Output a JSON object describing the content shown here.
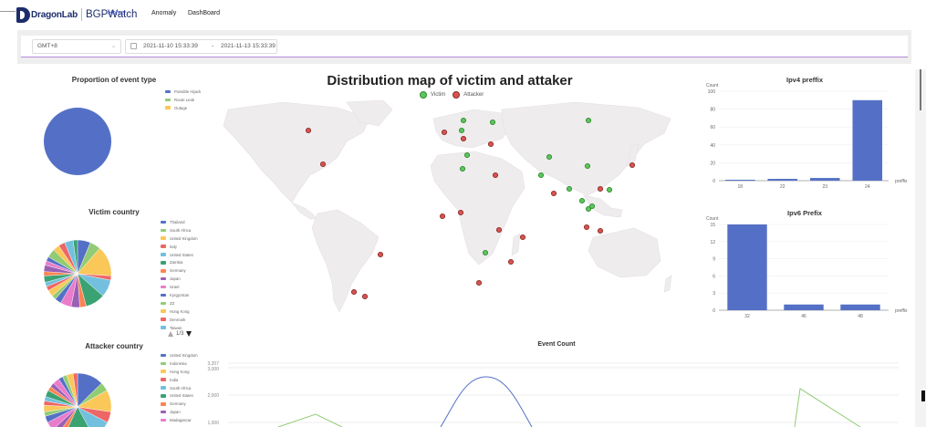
{
  "app": {
    "logo_text": "DragonLab",
    "logo_sub": "BGPWatch"
  },
  "nav": [
    {
      "label": "Home",
      "active": true
    },
    {
      "label": "Anomaly",
      "active": false
    },
    {
      "label": "DashBoard",
      "active": false
    }
  ],
  "filter": {
    "timezone": "GMT+8",
    "start": "2021-11-10 15:33:39",
    "separator": "-",
    "end": "2021-11-13 15:33:39"
  },
  "panels": {
    "event_type": {
      "title": "Proportion of event type",
      "legend": [
        "Possible Hijack",
        "Route Leak",
        "Outage"
      ],
      "colors": [
        "#5470c6",
        "#91cc75",
        "#fac858"
      ],
      "values": [
        1,
        0,
        0
      ]
    },
    "victim_country": {
      "title": "Victim country",
      "legend": [
        "Thailand",
        "South Africa",
        "United Kingdom",
        "Italy",
        "United States",
        "Zambia",
        "Germany",
        "Japan",
        "Israel",
        "Kyrgyzstan",
        "ZZ",
        "Hong Kong",
        "Denmark",
        "Taiwan"
      ],
      "pager": "1/3"
    },
    "attacker_country": {
      "title": "Attacker country",
      "legend": [
        "United Kingdom",
        "Indonesia",
        "Hong Kong",
        "India",
        "South Africa",
        "United States",
        "Germany",
        "Japan",
        "Madagascar"
      ]
    },
    "map": {
      "title": "Distribution map of victim and attaker",
      "legend_victim": "Victim",
      "legend_attacker": "Attacker"
    },
    "event_count": {
      "title": "Event Count",
      "y_ticks": [
        "3,207",
        "3,000",
        "2,000",
        "1,000"
      ]
    }
  },
  "legend_colors": [
    "#5470c6",
    "#91cc75",
    "#fac858",
    "#ee6666",
    "#73c0de",
    "#3ba272",
    "#fc8452",
    "#9a60b4",
    "#ea7ccc"
  ],
  "chart_data": [
    {
      "type": "bar",
      "title": "Ipv4 preffix",
      "ylabel": "Count",
      "xlabel": "preffix",
      "categories": [
        "18",
        "22",
        "23",
        "24"
      ],
      "values": [
        1,
        2,
        3,
        90
      ],
      "ylim": [
        0,
        100
      ],
      "y_ticks": [
        0,
        20,
        40,
        60,
        80,
        100
      ]
    },
    {
      "type": "bar",
      "title": "Ipv6 Prefix",
      "ylabel": "Count",
      "xlabel": "preffix",
      "categories": [
        "32",
        "46",
        "48"
      ],
      "values": [
        15,
        1,
        1
      ],
      "ylim": [
        0,
        15
      ],
      "y_ticks": [
        0,
        3,
        6,
        9,
        12,
        15
      ]
    }
  ]
}
